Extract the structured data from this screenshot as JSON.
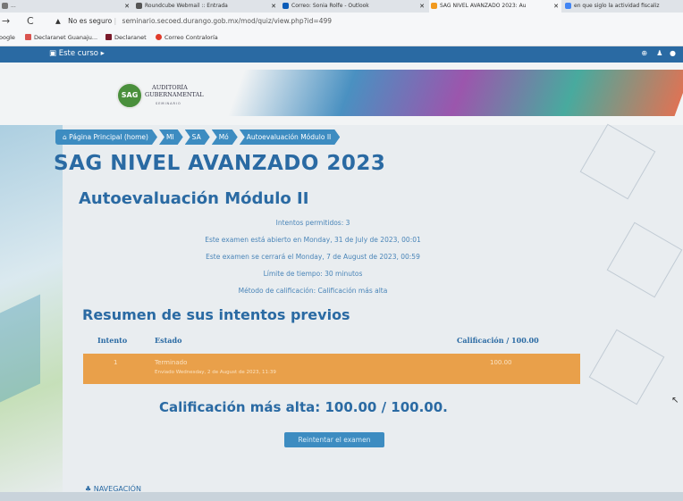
{
  "browser": {
    "tabs": [
      {
        "label": "...",
        "icon_color": "#777777"
      },
      {
        "label": "Roundcube Webmail :: Entrada",
        "icon_color": "#555555"
      },
      {
        "label": "Correo: Sonia Rolfe - Outlook",
        "icon_color": "#0a5cb8"
      },
      {
        "label": "SAG NIVEL AVANZADO 2023: Au",
        "icon_color": "#f29a1f"
      },
      {
        "label": "en que siglo la actividad fiscaliz",
        "icon_color": "#4285f4"
      }
    ],
    "security_label": "No es seguro",
    "url": "seminario.secoed.durango.gob.mx/mod/quiz/view.php?id=499",
    "bookmarks": [
      "Google",
      "Declaranet Guanaju...",
      "Declaranet",
      "Correo Contraloría"
    ]
  },
  "moodle": {
    "course_menu": "Este curso ▸",
    "logo": {
      "initials": "SAG",
      "line1": "AUDITORÍA",
      "line2": "GUBERNAMENTAL",
      "sub": "SEMINARIO"
    },
    "breadcrumb": [
      "Página Principal (home)",
      "MI",
      "SA",
      "Mó",
      "Autoevaluación Módulo II"
    ],
    "course_title": "SAG NIVEL AVANZADO 2023",
    "quiz_title": "Autoevaluación Módulo II",
    "info": [
      "Intentos permitidos: 3",
      "Este examen está abierto en Monday, 31 de July de 2023, 00:01",
      "Este examen se cerrará el Monday, 7 de August de 2023, 00:59",
      "Límite de tiempo: 30 minutos",
      "Método de calificación: Calificación más alta"
    ],
    "summary_title": "Resumen de sus intentos previos",
    "table": {
      "headers": {
        "attempt": "Intento",
        "state": "Estado",
        "grade": "Calificación / 100.00"
      },
      "rows": [
        {
          "attempt": "1",
          "state": "Terminado",
          "submitted": "Enviado Wednesday, 2 de August de 2023, 11:39",
          "grade": "100.00"
        }
      ]
    },
    "best_grade": "Calificación más alta: 100.00 / 100.00.",
    "retry_button": "Reintentar el examen",
    "navigation_label": "NAVEGACIÓN"
  },
  "colors": {
    "brand_blue": "#2a6aa3",
    "accent_orange": "#e9a04a"
  }
}
